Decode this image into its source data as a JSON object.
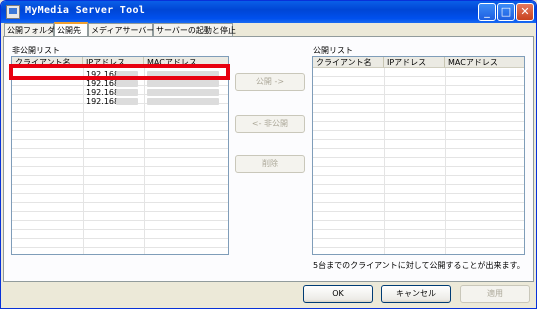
{
  "window": {
    "title": "MyMedia Server Tool"
  },
  "titlebar_buttons": {
    "minimize": "_",
    "maximize": "□",
    "close": "✕"
  },
  "tabs": [
    {
      "label": "公開フォルダ"
    },
    {
      "label": "公開先"
    },
    {
      "label": "メディアサーバー名"
    },
    {
      "label": "サーバーの起動と停止"
    }
  ],
  "left_list": {
    "label": "非公開リスト",
    "columns": [
      "クライアント名",
      "IPアドレス",
      "MACアドレス"
    ],
    "rows": [
      {
        "client": "",
        "ip": "192.168."
      },
      {
        "client": "",
        "ip": "192.168."
      },
      {
        "client": "",
        "ip": "192.168."
      },
      {
        "client": "",
        "ip": "192.168."
      }
    ]
  },
  "right_list": {
    "label": "公開リスト",
    "columns": [
      "クライアント名",
      "IPアドレス",
      "MACアドレス"
    ]
  },
  "middle_buttons": {
    "publish": "公開 ->",
    "unpublish": "<- 非公開",
    "delete": "削除"
  },
  "status_text": "5台までのクライアントに対して公開することが出来ます。",
  "dialog_buttons": {
    "ok": "OK",
    "cancel": "キャンセル",
    "apply": "適用"
  },
  "colors": {
    "highlight": "#E8000F",
    "titlebar": "#0050EE"
  }
}
